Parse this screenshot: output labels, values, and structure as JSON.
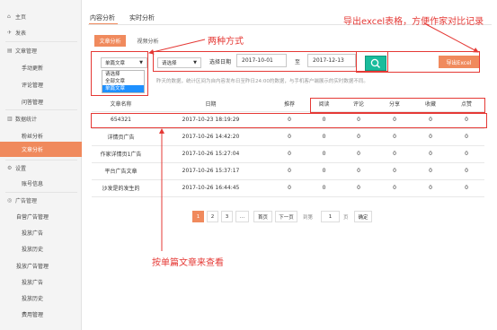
{
  "sidebar": {
    "items": [
      {
        "icon": "home-icon",
        "label": "主页",
        "level": "top"
      },
      {
        "icon": "send-icon",
        "label": "发表",
        "level": "top"
      },
      {
        "icon": "document-icon",
        "label": "文章管理",
        "level": "top"
      },
      {
        "label": "手动更新",
        "level": "sub"
      },
      {
        "label": "评论管理",
        "level": "sub"
      },
      {
        "label": "问答管理",
        "level": "sub"
      },
      {
        "icon": "bar-chart-icon",
        "label": "数据统计",
        "level": "top"
      },
      {
        "label": "粉丝分析",
        "level": "sub"
      },
      {
        "label": "文章分析",
        "level": "sub",
        "active": true
      },
      {
        "icon": "gear-icon",
        "label": "设置",
        "level": "top"
      },
      {
        "label": "账号信息",
        "level": "sub"
      },
      {
        "icon": "globe-icon",
        "label": "广告管理",
        "level": "top"
      },
      {
        "label": "自营广告管理",
        "level": "sub"
      },
      {
        "label": "投放广告",
        "level": "sub"
      },
      {
        "label": "投放历史",
        "level": "sub"
      },
      {
        "label": "投放广告管理",
        "level": "sub"
      },
      {
        "label": "投放广告",
        "level": "sub"
      },
      {
        "label": "投放历史",
        "level": "sub"
      },
      {
        "label": "费用管理",
        "level": "sub"
      }
    ]
  },
  "tabs": {
    "content": "内容分析",
    "realtime": "实时分析"
  },
  "subtabs": {
    "article": "文章分析",
    "video": "视频分析"
  },
  "filters": {
    "type_select": "单篇文章",
    "type_options": [
      "请选择",
      "全部文章",
      "单篇文章"
    ],
    "second_select": "请选择",
    "date_label": "选择日期",
    "date_from": "2017-10-01",
    "date_sep": "至",
    "date_to": "2017-12-13",
    "export_label": "导出Excel"
  },
  "note": "昨天的数据，统计区间为自内容发布日至昨日24:00的数据，与手机客户端展示的实时数据不同。",
  "table": {
    "headers": [
      "文章名称",
      "日期",
      "推荐",
      "阅读",
      "评论",
      "分享",
      "收藏",
      "点赞"
    ],
    "rows": [
      [
        "654321",
        "2017-10-23 18:19:29",
        "0",
        "0",
        "0",
        "0",
        "0",
        "0"
      ],
      [
        "详情页广告",
        "2017-10-26 14:42:20",
        "0",
        "0",
        "0",
        "0",
        "0",
        "0"
      ],
      [
        "作家详情页1广告",
        "2017-10-26 15:27:04",
        "0",
        "0",
        "0",
        "0",
        "0",
        "0"
      ],
      [
        "平台广告文章",
        "2017-10-26 15:37:17",
        "0",
        "0",
        "0",
        "0",
        "0",
        "0"
      ],
      [
        "沙发是的发生的",
        "2017-10-26 16:44:45",
        "0",
        "0",
        "0",
        "0",
        "0",
        "0"
      ]
    ]
  },
  "pagination": {
    "pages": [
      "1",
      "2",
      "3",
      "..."
    ],
    "first": "首页",
    "next": "下一页",
    "goto_label": "到第",
    "page_input": "1",
    "page_unit": "页",
    "confirm": "确定"
  },
  "annotations": {
    "two_ways": "两种方式",
    "export_note": "导出excel表格，方便作家对比记录",
    "single_view": "按单篇文章来查看"
  },
  "colors": {
    "accent": "#f08a5d",
    "search": "#1abc9c",
    "annotation": "#e53935",
    "selected_option": "#1e90ff"
  }
}
